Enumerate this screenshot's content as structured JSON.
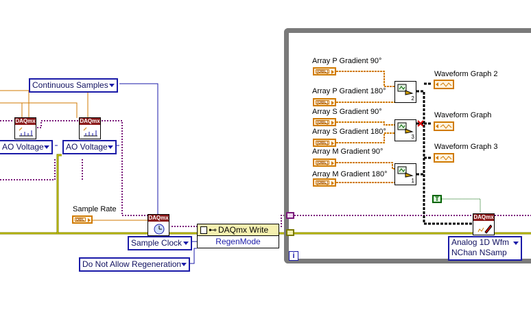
{
  "rings": {
    "continuous_samples": "Continuous Samples",
    "ao_voltage_1": "AO Voltage",
    "ao_voltage_2": "AO Voltage",
    "sample_clock": "Sample Clock",
    "do_not_allow_regen": "Do Not Allow Regeneration",
    "analog_write_line1": "Analog 1D Wfm",
    "analog_write_line2": "NChan NSamp"
  },
  "labels": {
    "sample_rate": "Sample Rate",
    "array_p_90": "Array P Gradient 90°",
    "array_p_180": "Array P Gradient 180°",
    "array_s_90": "Array S Gradient 90°",
    "array_s_180": "Array S Gradient 180°",
    "array_m_90": "Array M Gradient 90°",
    "array_m_180": "Array M Gradient 180°",
    "waveform_graph_2": "Waveform Graph 2",
    "waveform_graph": "Waveform Graph",
    "waveform_graph_3": "Waveform Graph 3"
  },
  "controls": {
    "sample_rate_type": "DBL",
    "array_type": "[DBL]"
  },
  "vi": {
    "daqmx_header": "DAQmx"
  },
  "subvi_numbers": [
    "2",
    "3",
    "1"
  ],
  "property_node": {
    "title": "DAQmx Write",
    "property": "RegenMode"
  },
  "bool_constant": "T",
  "iteration_terminal": "i",
  "colors": {
    "error_wire": "#c8c800",
    "task_wire": "#7a1a7a",
    "enum_wire": "#1a1aa8",
    "numeric_wire": "#d07a00",
    "bool_wire": "#006400",
    "loop_border": "#7a7a7a"
  }
}
